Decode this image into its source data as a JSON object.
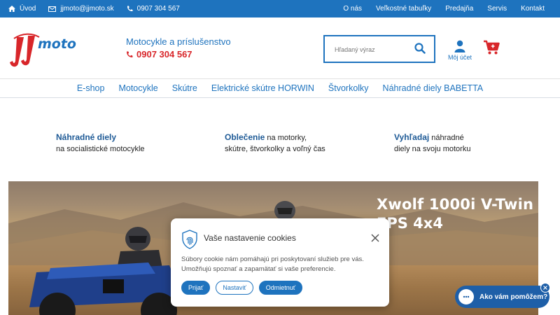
{
  "topbar": {
    "home_label": "Úvod",
    "email": "jjmoto@jjmoto.sk",
    "phone": "0907 304 567",
    "links": [
      "O nás",
      "Veľkostné tabuľky",
      "Predajňa",
      "Servis",
      "Kontakt"
    ]
  },
  "header": {
    "logo_text": "moto",
    "tagline": "Motocykle a príslušenstvo",
    "phone": "0907 304 567",
    "search_placeholder": "Hľadaný výraz",
    "account_label": "Môj účet"
  },
  "nav": {
    "items": [
      "E-shop",
      "Motocykle",
      "Skútre",
      "Elektrické skútre HORWIN",
      "Štvorkolky",
      "Náhradné diely BABETTA"
    ]
  },
  "features": [
    {
      "bold": "Náhradné diely",
      "rest1": "",
      "line2": "na socialistické motocykle"
    },
    {
      "bold": "Oblečenie",
      "rest1": " na motorky,",
      "line2": "skútre, štvorkolky a voľný čas"
    },
    {
      "bold": "Vyhľadaj",
      "rest1": " náhradné",
      "line2": "diely na svoju motorku"
    }
  ],
  "hero": {
    "title_line1": "Xwolf 1000i V-Twin",
    "title_line2": "EPS 4x4"
  },
  "cookie": {
    "title": "Vaše nastavenie cookies",
    "text": "Súbory cookie nám pomáhajú pri poskytovaní služieb pre vás. Umožňujú spoznať a zapamätať si vaše preferencie.",
    "accept": "Prijať",
    "settings": "Nastaviť",
    "reject": "Odmietnuť"
  },
  "chat": {
    "label": "Ako vám pomôžem?"
  },
  "colors": {
    "primary": "#1e73be",
    "accent_red": "#d8262a",
    "chat": "#1e5fa8"
  }
}
